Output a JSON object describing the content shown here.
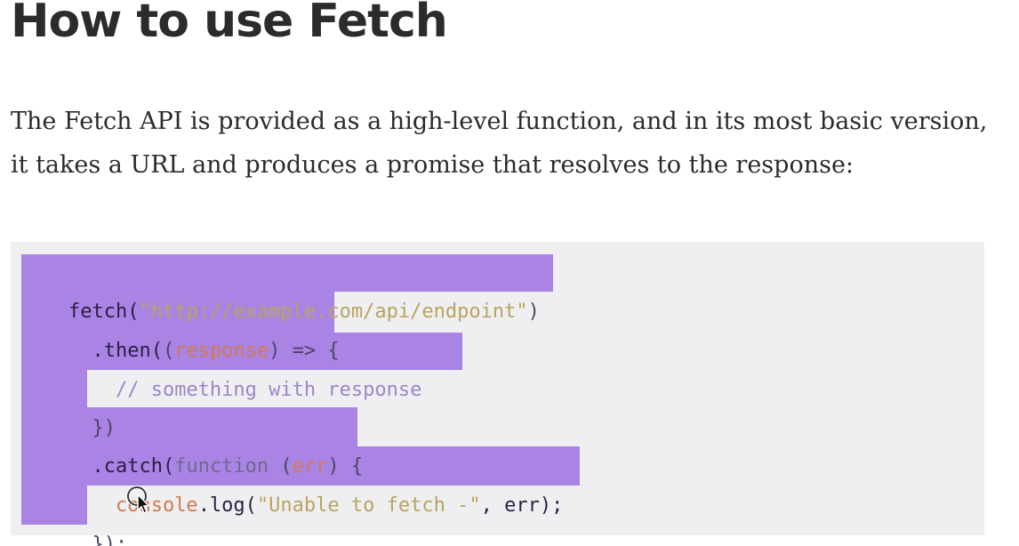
{
  "article": {
    "title": "How to use Fetch",
    "paragraph": "The Fetch API is provided as a high-level function, and in its most basic version, it takes a URL and produces a promise that resolves to the response:"
  },
  "code": {
    "l1_fetch": "fetch(",
    "l1_url": "\"http://example.com/api/endpoint\"",
    "l1_close": ")",
    "l2_then": "  .then(",
    "l2_open": "(",
    "l2_param": "response",
    "l2_arrow": ") => {",
    "l3_comment": "    // something with response",
    "l4_close": "  })",
    "l5_catch": "  .catch(",
    "l5_function": "function",
    "l5_open": " (",
    "l5_param": "err",
    "l5_brace": ") {",
    "l6_console": "    console",
    "l6_log": ".log(",
    "l6_msg": "\"Unable to fetch -\"",
    "l6_rest": ", err);",
    "l7_close": "  });"
  },
  "colors": {
    "selection": "#a984e5",
    "code_background": "#efeff1",
    "heading": "#2b2b2b"
  },
  "icons": [
    "mouse-pointer-cursor-icon"
  ]
}
